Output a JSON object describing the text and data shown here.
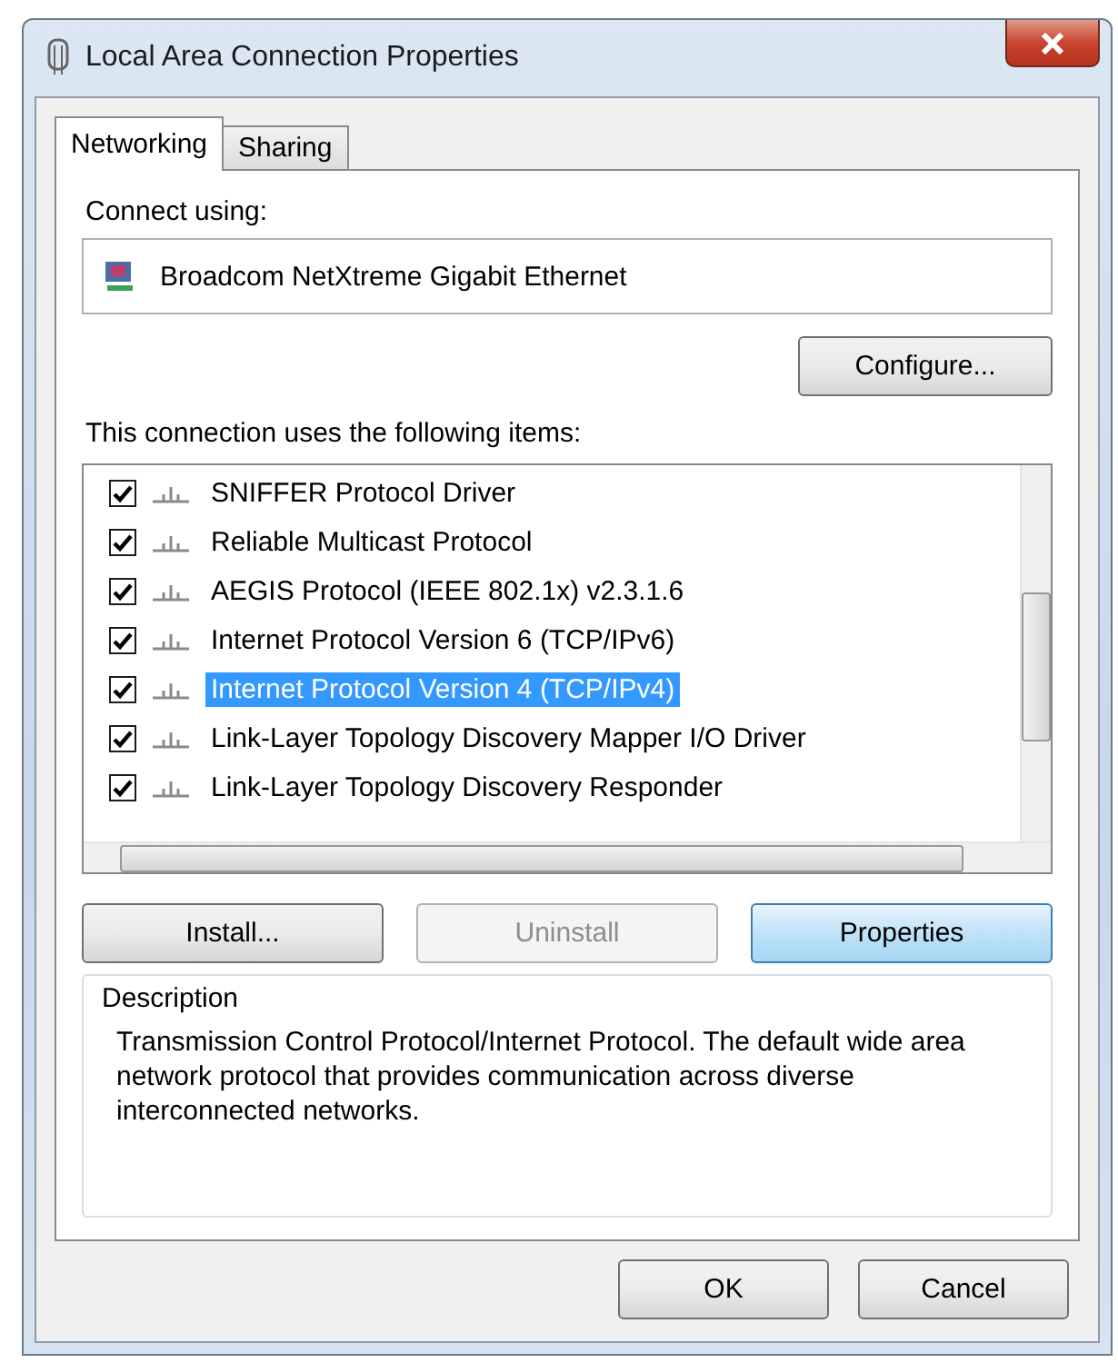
{
  "window": {
    "title": "Local Area Connection Properties"
  },
  "tabs": [
    {
      "label": "Networking",
      "selected": true
    },
    {
      "label": "Sharing",
      "selected": false
    }
  ],
  "connect_using": {
    "label": "Connect using:",
    "adapter": "Broadcom NetXtreme Gigabit Ethernet"
  },
  "configure_button": "Configure...",
  "items_label": "This connection uses the following items:",
  "items": [
    {
      "label": "SNIFFER Protocol Driver",
      "checked": true,
      "selected": false
    },
    {
      "label": "Reliable Multicast Protocol",
      "checked": true,
      "selected": false
    },
    {
      "label": "AEGIS Protocol (IEEE 802.1x) v2.3.1.6",
      "checked": true,
      "selected": false
    },
    {
      "label": "Internet Protocol Version 6 (TCP/IPv6)",
      "checked": true,
      "selected": false
    },
    {
      "label": "Internet Protocol Version 4 (TCP/IPv4)",
      "checked": true,
      "selected": true
    },
    {
      "label": "Link-Layer Topology Discovery Mapper I/O Driver",
      "checked": true,
      "selected": false
    },
    {
      "label": "Link-Layer Topology Discovery Responder",
      "checked": true,
      "selected": false
    }
  ],
  "item_buttons": [
    {
      "label": "Install...",
      "disabled": false,
      "highlighted": false
    },
    {
      "label": "Uninstall",
      "disabled": true,
      "highlighted": false
    },
    {
      "label": "Properties",
      "disabled": false,
      "highlighted": true
    }
  ],
  "description": {
    "label": "Description",
    "text": "Transmission Control Protocol/Internet Protocol. The default wide area network protocol that provides communication across diverse interconnected networks."
  },
  "dialog_buttons": [
    "OK",
    "Cancel"
  ]
}
